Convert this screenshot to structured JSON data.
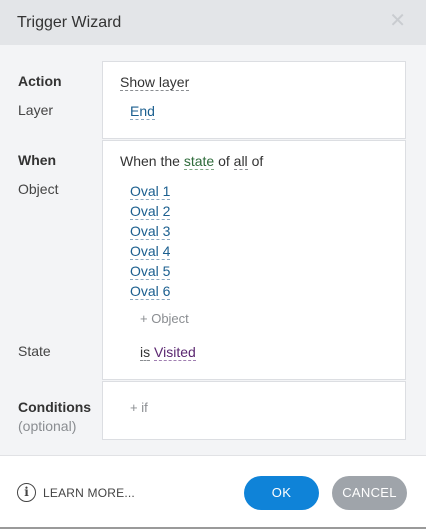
{
  "dialog": {
    "title": "Trigger Wizard",
    "close_glyph": "✕"
  },
  "labels": {
    "action": "Action",
    "layer": "Layer",
    "when": "When",
    "object": "Object",
    "state": "State",
    "conditions": "Conditions",
    "optional": "(optional)"
  },
  "action_panel": {
    "action_value": "Show layer",
    "layer_value": "End"
  },
  "when_panel": {
    "prefix": "When the",
    "state_word": "state",
    "of_word": "of",
    "all_word": "all",
    "of_word_2": "of",
    "objects": [
      "Oval 1",
      "Oval 2",
      "Oval 3",
      "Oval 4",
      "Oval 5",
      "Oval 6"
    ],
    "add_object": "+ Object",
    "is_word": "is",
    "state_value": "Visited"
  },
  "conditions_panel": {
    "add_if": "+ if"
  },
  "footer": {
    "learn_more": "LEARN MORE...",
    "info_icon": "i",
    "ok": "OK",
    "cancel": "CANCEL"
  },
  "colors": {
    "accent": "#0f83d8",
    "cancel": "#9fa4aa",
    "titlebar": "#e3e5e8"
  }
}
